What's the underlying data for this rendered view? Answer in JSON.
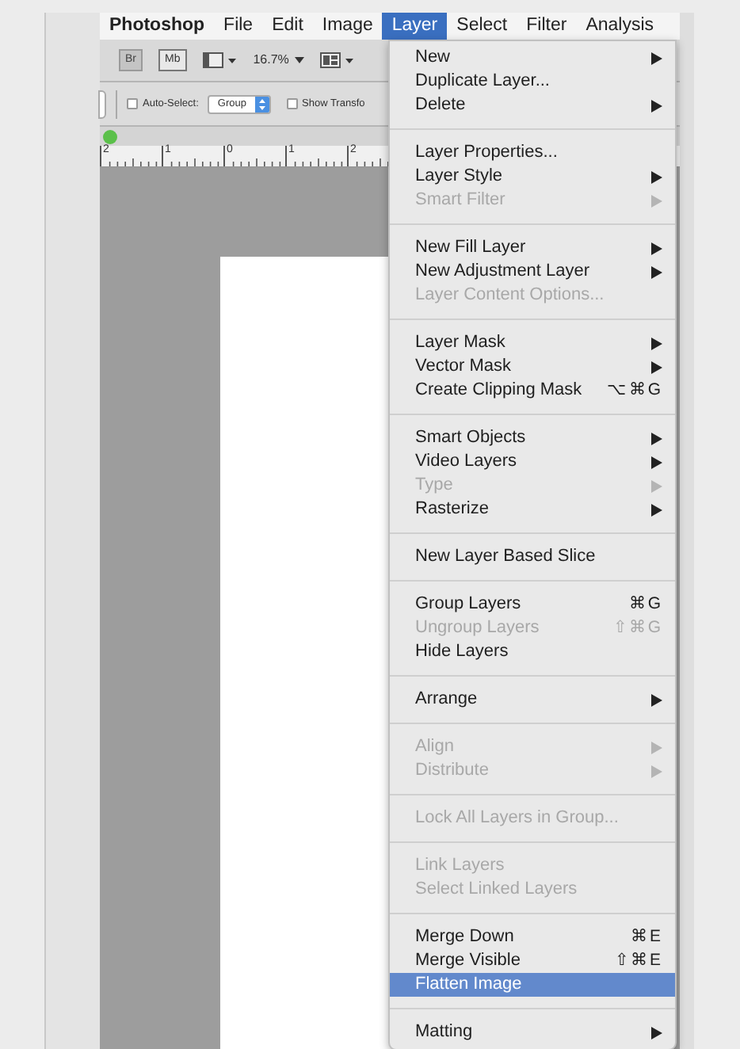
{
  "menu_bar": [
    {
      "label": "Photoshop",
      "selected": false
    },
    {
      "label": "File",
      "selected": false
    },
    {
      "label": "Edit",
      "selected": false
    },
    {
      "label": "Image",
      "selected": false
    },
    {
      "label": "Layer",
      "selected": true
    },
    {
      "label": "Select",
      "selected": false
    },
    {
      "label": "Filter",
      "selected": false
    },
    {
      "label": "Analysis",
      "selected": false
    }
  ],
  "toolbar": {
    "bridge_button": "Br",
    "mini_bridge_button": "Mb",
    "zoom": "16.7%"
  },
  "options_bar": {
    "auto_select": {
      "label": "Auto-Select:",
      "checked": false
    },
    "auto_select_target": "Group",
    "show_transform": {
      "label": "Show Transfo",
      "checked": false
    }
  },
  "ruler": [
    "2",
    "1",
    "0",
    "1",
    "2"
  ],
  "layer_menu": [
    [
      {
        "label": "New",
        "submenu": true,
        "disabled": false,
        "selected": false
      },
      {
        "label": "Duplicate Layer...",
        "submenu": false,
        "disabled": false,
        "selected": false
      },
      {
        "label": "Delete",
        "submenu": true,
        "disabled": false,
        "selected": false
      }
    ],
    [
      {
        "label": "Layer Properties...",
        "submenu": false,
        "disabled": false,
        "selected": false
      },
      {
        "label": "Layer Style",
        "submenu": true,
        "disabled": false,
        "selected": false
      },
      {
        "label": "Smart Filter",
        "submenu": true,
        "disabled": true,
        "selected": false
      }
    ],
    [
      {
        "label": "New Fill Layer",
        "submenu": true,
        "disabled": false,
        "selected": false
      },
      {
        "label": "New Adjustment Layer",
        "submenu": true,
        "disabled": false,
        "selected": false
      },
      {
        "label": "Layer Content Options...",
        "submenu": false,
        "disabled": true,
        "selected": false
      }
    ],
    [
      {
        "label": "Layer Mask",
        "submenu": true,
        "disabled": false,
        "selected": false
      },
      {
        "label": "Vector Mask",
        "submenu": true,
        "disabled": false,
        "selected": false
      },
      {
        "label": "Create Clipping Mask",
        "shortcut": "⌥⌘G",
        "submenu": false,
        "disabled": false,
        "selected": false
      }
    ],
    [
      {
        "label": "Smart Objects",
        "submenu": true,
        "disabled": false,
        "selected": false
      },
      {
        "label": "Video Layers",
        "submenu": true,
        "disabled": false,
        "selected": false
      },
      {
        "label": "Type",
        "submenu": true,
        "disabled": true,
        "selected": false
      },
      {
        "label": "Rasterize",
        "submenu": true,
        "disabled": false,
        "selected": false
      }
    ],
    [
      {
        "label": "New Layer Based Slice",
        "submenu": false,
        "disabled": false,
        "selected": false
      }
    ],
    [
      {
        "label": "Group Layers",
        "shortcut": "⌘G",
        "submenu": false,
        "disabled": false,
        "selected": false
      },
      {
        "label": "Ungroup Layers",
        "shortcut": "⇧⌘G",
        "submenu": false,
        "disabled": true,
        "selected": false
      },
      {
        "label": "Hide Layers",
        "submenu": false,
        "disabled": false,
        "selected": false
      }
    ],
    [
      {
        "label": "Arrange",
        "submenu": true,
        "disabled": false,
        "selected": false
      }
    ],
    [
      {
        "label": "Align",
        "submenu": true,
        "disabled": true,
        "selected": false
      },
      {
        "label": "Distribute",
        "submenu": true,
        "disabled": true,
        "selected": false
      }
    ],
    [
      {
        "label": "Lock All Layers in Group...",
        "submenu": false,
        "disabled": true,
        "selected": false
      }
    ],
    [
      {
        "label": "Link Layers",
        "submenu": false,
        "disabled": true,
        "selected": false
      },
      {
        "label": "Select Linked Layers",
        "submenu": false,
        "disabled": true,
        "selected": false
      }
    ],
    [
      {
        "label": "Merge Down",
        "shortcut": "⌘E",
        "submenu": false,
        "disabled": false,
        "selected": false
      },
      {
        "label": "Merge Visible",
        "shortcut": "⇧⌘E",
        "submenu": false,
        "disabled": false,
        "selected": false
      },
      {
        "label": "Flatten Image",
        "submenu": false,
        "disabled": false,
        "selected": true
      }
    ],
    [
      {
        "label": "Matting",
        "submenu": true,
        "disabled": false,
        "selected": false
      }
    ]
  ]
}
